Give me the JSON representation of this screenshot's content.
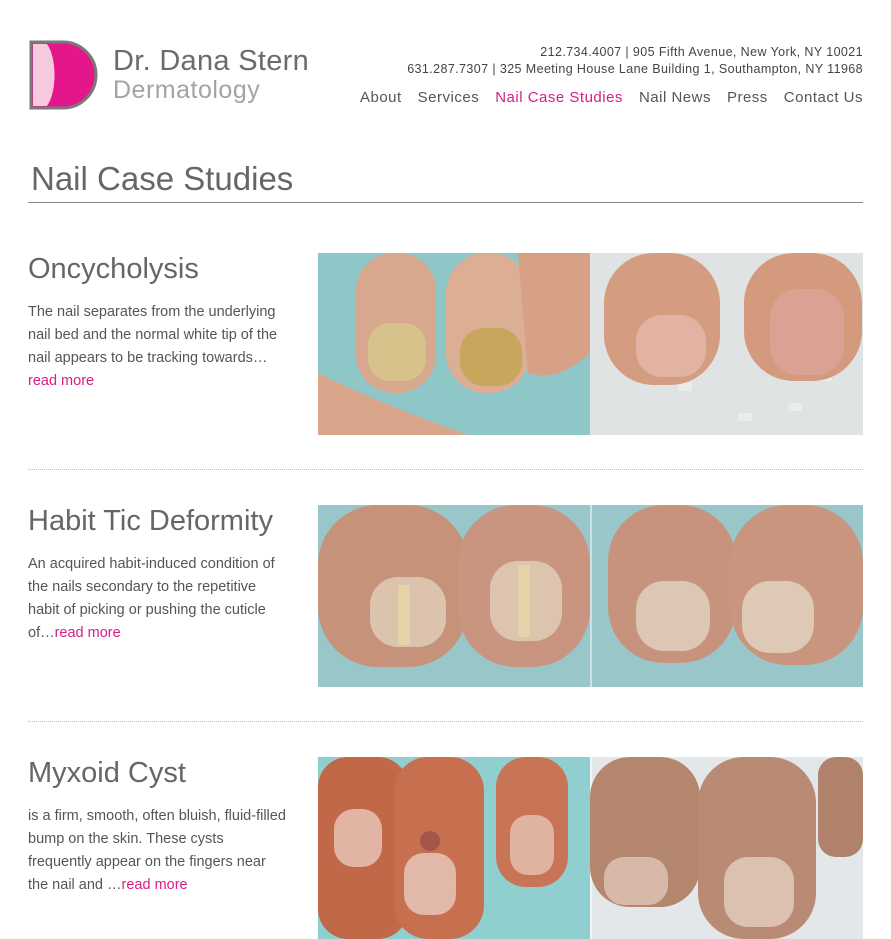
{
  "header": {
    "logo_name": "Dr. Dana Stern",
    "logo_sub": "Dermatology",
    "contact_line_1": "212.734.4007 | 905 Fifth Avenue, New York, NY 10021",
    "contact_line_2": "631.287.7307 | 325 Meeting House Lane Building 1, Southampton, NY 11968"
  },
  "nav": {
    "about": "About",
    "services": "Services",
    "nail_case_studies": "Nail Case Studies",
    "nail_news": "Nail News",
    "press": "Press",
    "contact_us": "Contact Us"
  },
  "page": {
    "title": "Nail Case Studies"
  },
  "cases": [
    {
      "title": "Oncycholysis",
      "description": "The nail separates from the underlying nail bed and the normal white tip of the nail appears to be tracking towards…",
      "read_more": "read more"
    },
    {
      "title": "Habit Tic Deformity",
      "description": "An acquired habit-induced condition of the nails secondary to the repetitive habit of picking or pushing the cuticle of…",
      "read_more": "read more"
    },
    {
      "title": "Myxoid Cyst",
      "description": "is a firm, smooth, often bluish, fluid-filled bump on the skin.  These cysts frequently appear on the fingers near the nail and …",
      "read_more": "read more"
    }
  ],
  "colors": {
    "accent": "#d81d86",
    "text": "#595959",
    "logo_pink": "#e3168b",
    "logo_light_pink": "#f6c9dd"
  }
}
